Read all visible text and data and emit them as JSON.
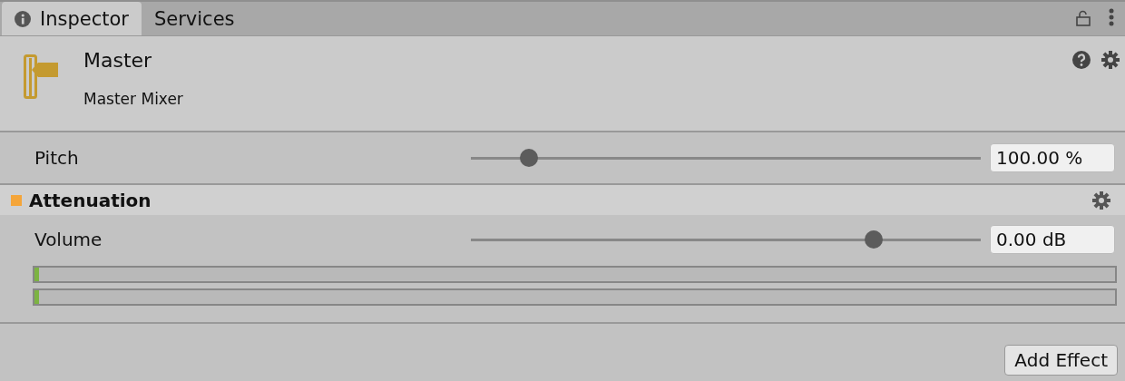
{
  "tabs": [
    {
      "label": "Inspector",
      "selected": true
    },
    {
      "label": "Services",
      "selected": false
    }
  ],
  "header": {
    "title": "Master",
    "subtitle": "Master Mixer"
  },
  "pitch": {
    "label": "Pitch",
    "level": 0.114,
    "value": "100.00 %"
  },
  "attenuation": {
    "title": "Attenuation",
    "color": "#f4a53a",
    "volume": {
      "label": "Volume",
      "level": 0.79,
      "value": "0.00 dB"
    },
    "meters": [
      {
        "level": 0.004
      },
      {
        "level": 0.004
      }
    ]
  },
  "add_effect": "Add Effect"
}
